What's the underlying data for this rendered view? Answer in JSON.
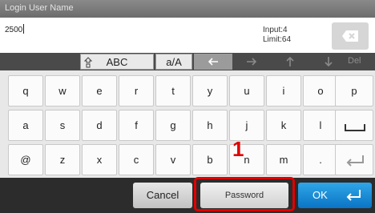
{
  "title": "Login User Name",
  "input": {
    "value": "2500",
    "info_line1": "Input:4",
    "info_line2": "Limit:64"
  },
  "backspace_icon": "backspace-x-icon",
  "mode": {
    "shift_icon": "shift-icon",
    "abc": "ABC",
    "case_toggle": "a/A",
    "del": "Del"
  },
  "rows": [
    [
      "q",
      "w",
      "e",
      "r",
      "t",
      "y",
      "u",
      "i",
      "o",
      "p"
    ],
    [
      "a",
      "s",
      "d",
      "f",
      "g",
      "h",
      "j",
      "k",
      "l"
    ],
    [
      "@",
      "z",
      "x",
      "c",
      "v",
      "b",
      "n",
      "m",
      "."
    ]
  ],
  "buttons": {
    "cancel": "Cancel",
    "password": "Password",
    "ok": "OK"
  },
  "callout": "1",
  "colors": {
    "ok": "#1a8cd8",
    "callout": "#e00000",
    "title_bar": "#7a7a7a"
  }
}
